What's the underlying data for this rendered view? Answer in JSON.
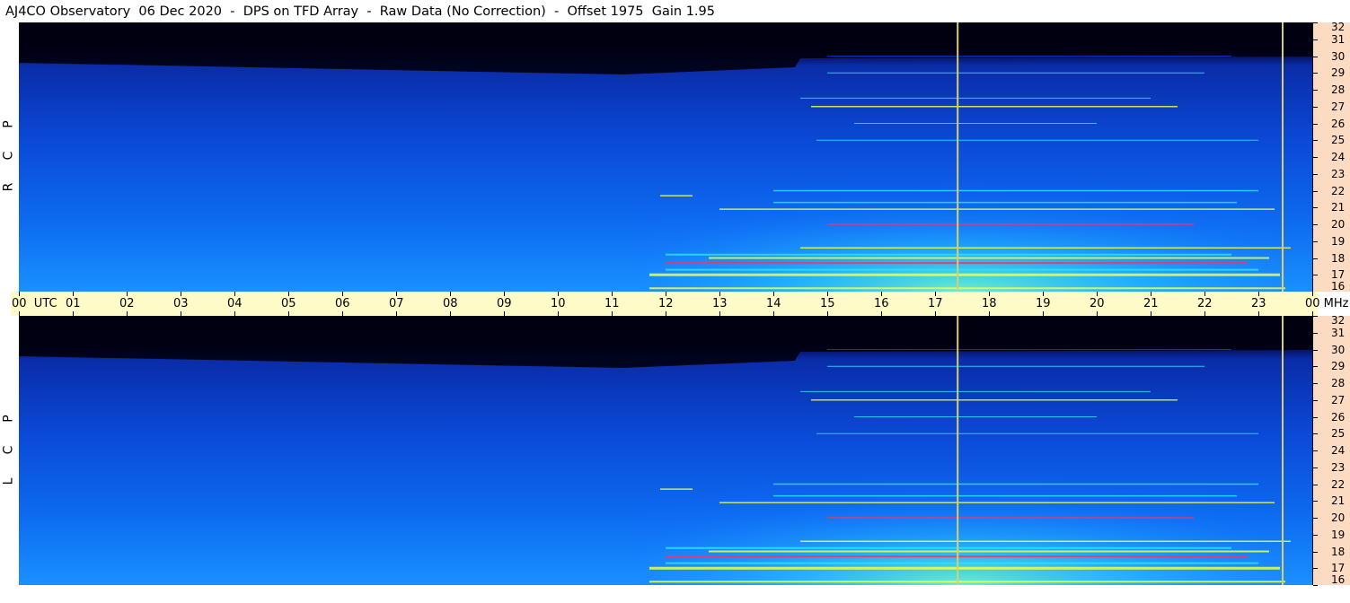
{
  "title": "AJ4CO Observatory  06 Dec 2020  -  DPS on TFD Array  -  Raw Data (No Correction)  -  Offset 1975  Gain 1.95",
  "chart_data": {
    "type": "heatmap",
    "panels": [
      {
        "id": "top",
        "polarization_letters": [
          "P",
          "C",
          "R"
        ]
      },
      {
        "id": "bottom",
        "polarization_letters": [
          "P",
          "C",
          "L"
        ]
      }
    ],
    "x": {
      "unit_label": "UTC",
      "tick_labels": [
        "00",
        "01",
        "02",
        "03",
        "04",
        "05",
        "06",
        "07",
        "08",
        "09",
        "10",
        "11",
        "12",
        "13",
        "14",
        "15",
        "16",
        "17",
        "18",
        "19",
        "20",
        "21",
        "22",
        "23",
        "00"
      ],
      "range_hours": [
        0,
        24
      ]
    },
    "y": {
      "unit_label": "MHz",
      "ticks": [
        16,
        17,
        18,
        19,
        20,
        21,
        22,
        23,
        24,
        25,
        26,
        27,
        28,
        29,
        30,
        31,
        32
      ],
      "range_mhz": [
        16,
        32
      ]
    },
    "vertical_markers_utc_hours": [
      17.42,
      23.45
    ],
    "colors": {
      "low": "#000010",
      "mid": "#0b3fd6",
      "high": "#2de0ff",
      "peak": "#f0ff40",
      "max": "#ff3060",
      "marker": "#d8d070"
    }
  }
}
